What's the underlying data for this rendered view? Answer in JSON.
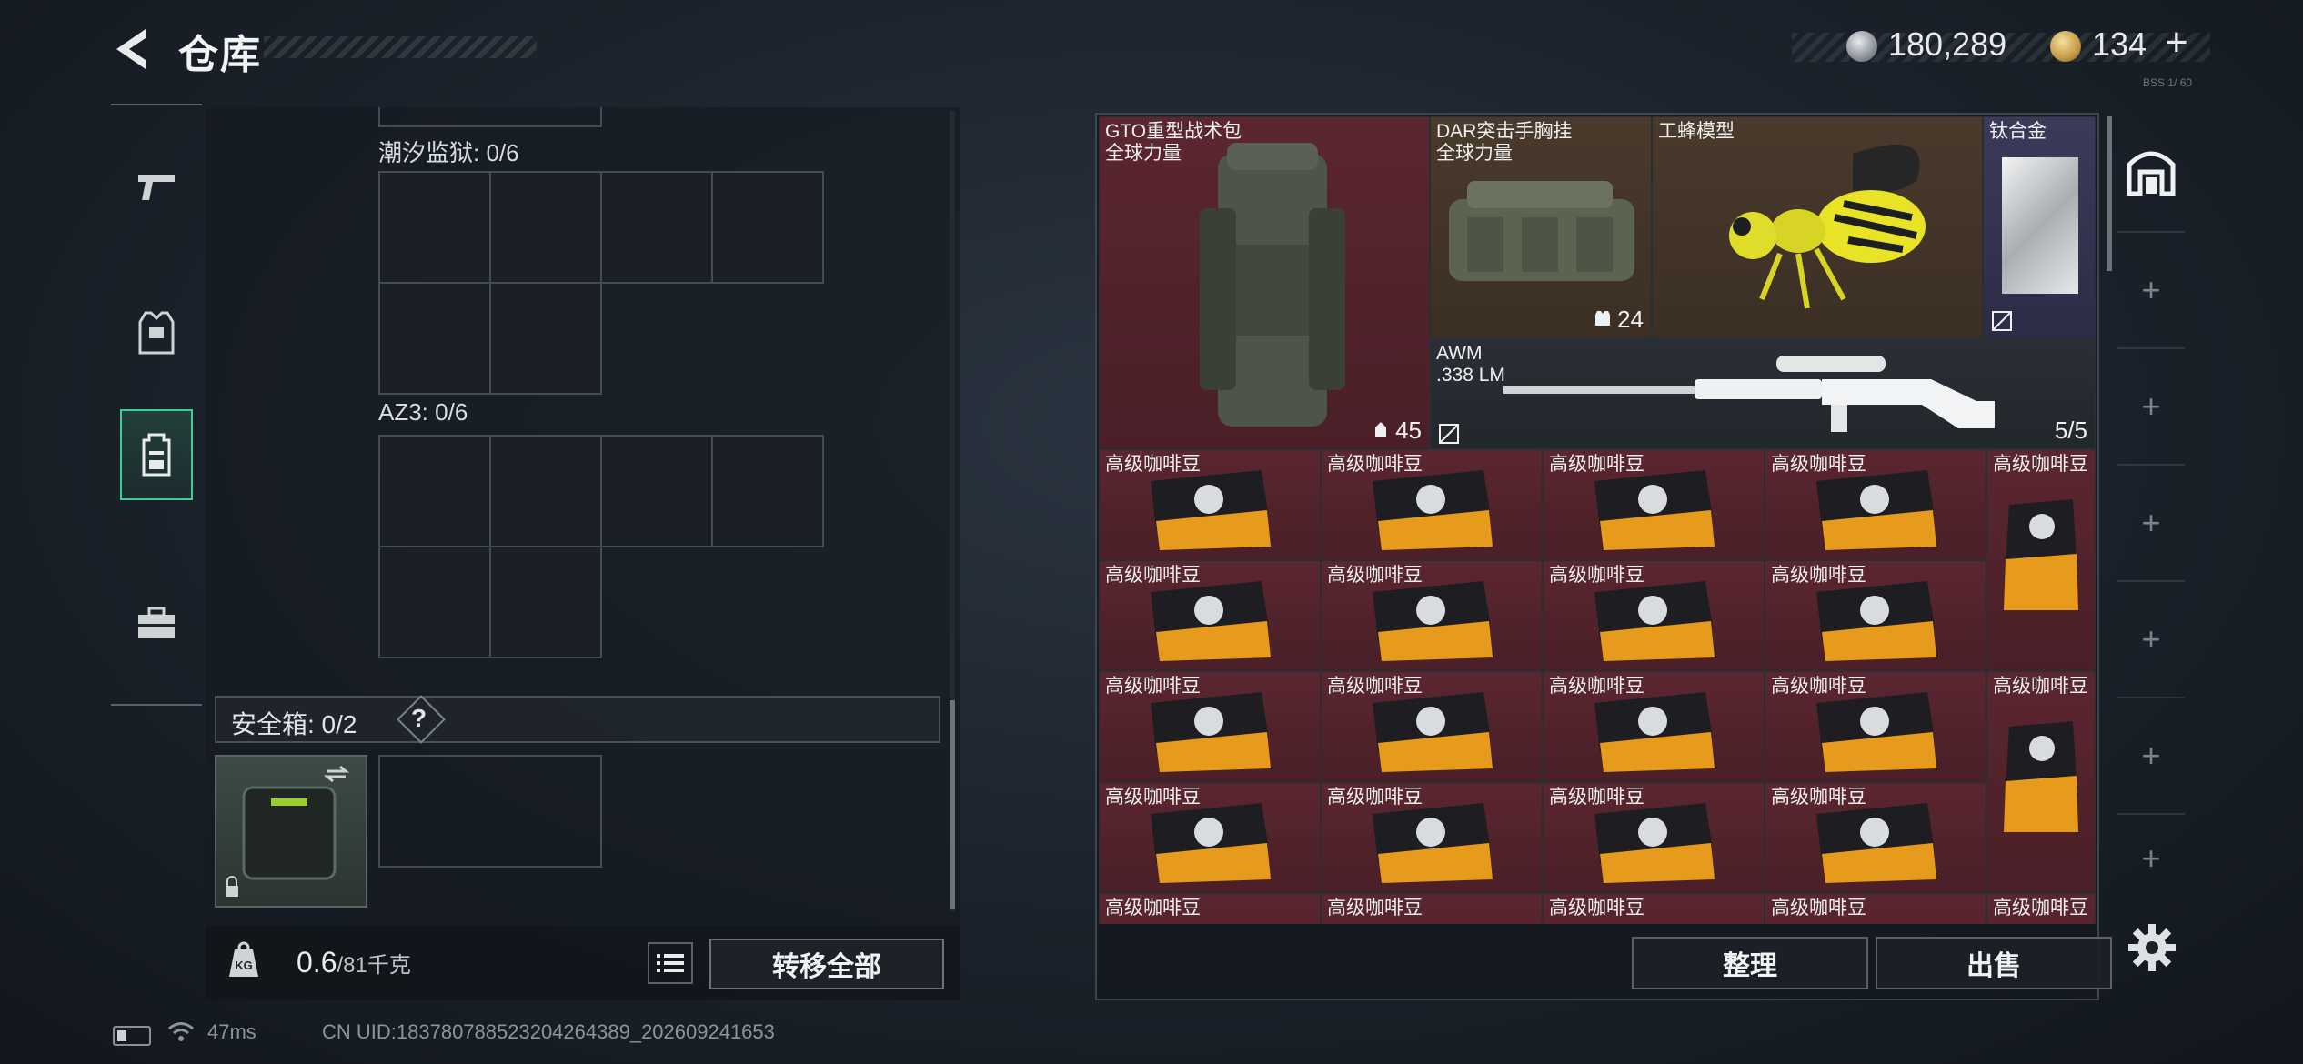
{
  "header": {
    "title": "仓库",
    "currency_silver": "180,289",
    "currency_gold": "134",
    "currency_add": "+",
    "corner_tag": "BSS 1/ 60"
  },
  "left_nav": [
    {
      "name": "weapons",
      "icon": "pistol-icon",
      "active": false
    },
    {
      "name": "armor",
      "icon": "vest-icon",
      "active": false
    },
    {
      "name": "backpack",
      "icon": "backpack-icon",
      "active": true
    },
    {
      "name": "toolbox",
      "icon": "toolbox-icon",
      "active": false
    }
  ],
  "containers": {
    "tide_prison_label": "潮汐监狱: 0/6",
    "az3_label": "AZ3: 0/6",
    "safe_box_label": "安全箱: 0/2",
    "safe_box_help": "?"
  },
  "weight": {
    "value": "0.6",
    "unit": "/81千克"
  },
  "buttons": {
    "transfer_all": "转移全部",
    "sort": "整理",
    "sell": "出售"
  },
  "status": {
    "ping": "47ms",
    "uid": "CN UID:18378078852320426438​9_202609241653"
  },
  "items": {
    "gto": {
      "name_line1": "GTO重型战术包",
      "name_line2": "全球力量",
      "count": "45"
    },
    "dar": {
      "name_line1": "DAR突击手胸挂",
      "name_line2": "全球力量",
      "count": "24"
    },
    "wasp": {
      "name": "工蜂模型"
    },
    "titanium": {
      "name": "钛合金"
    },
    "awm": {
      "name_line1": "AWM",
      "name_line2": ".338 LM",
      "count": "5/5"
    },
    "coffee": {
      "name": "高级咖啡豆"
    }
  },
  "colors": {
    "accent_green": "#3ecf8e",
    "rarity_red": "#5b2630",
    "rarity_brown": "#4a3a2c",
    "rarity_purple": "#3c3a5a"
  }
}
